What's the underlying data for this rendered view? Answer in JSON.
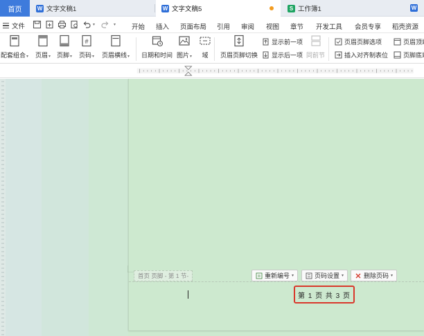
{
  "tabs": {
    "home": "首页",
    "doc1": "文字文稿1",
    "doc5": "文字文稿5",
    "sheet": "工作簿1",
    "w_glyph": "W",
    "s_glyph": "S"
  },
  "menubar": {
    "file": "文件",
    "items": [
      "开始",
      "插入",
      "页面布局",
      "引用",
      "审阅",
      "视图",
      "章节",
      "开发工具",
      "会员专享",
      "稻壳资源"
    ]
  },
  "ribbon": {
    "group_combo": "配套组合",
    "header": "页眉",
    "footer": "页脚",
    "page_number": "页码",
    "header_line": "页眉横线",
    "date_time": "日期和时间",
    "picture": "图片",
    "field": "域",
    "switch_header_footer": "页眉页脚切换",
    "show_prev": "显示前一项",
    "show_next": "显示后一项",
    "same_as_prev": "同前节",
    "header_footer_options": "页眉页脚选项",
    "insert_align_tab": "插入对齐制表位",
    "header_top_margin": "页眉顶端",
    "footer_bottom_margin": "页脚底端"
  },
  "page": {
    "footer_tag": "首页 页脚 - 第 1 节-",
    "renumber": "重新编号",
    "page_number_settings": "页码设置",
    "delete_page_number": "删除页码",
    "page_number_text": "第 1 页 共 3 页"
  },
  "colors": {
    "accent": "#3e7bdc",
    "page_bg": "#cde9cf",
    "highlight_border": "#d9372b",
    "writer_icon": "#2f6fd8",
    "sheet_icon": "#1ea462"
  }
}
